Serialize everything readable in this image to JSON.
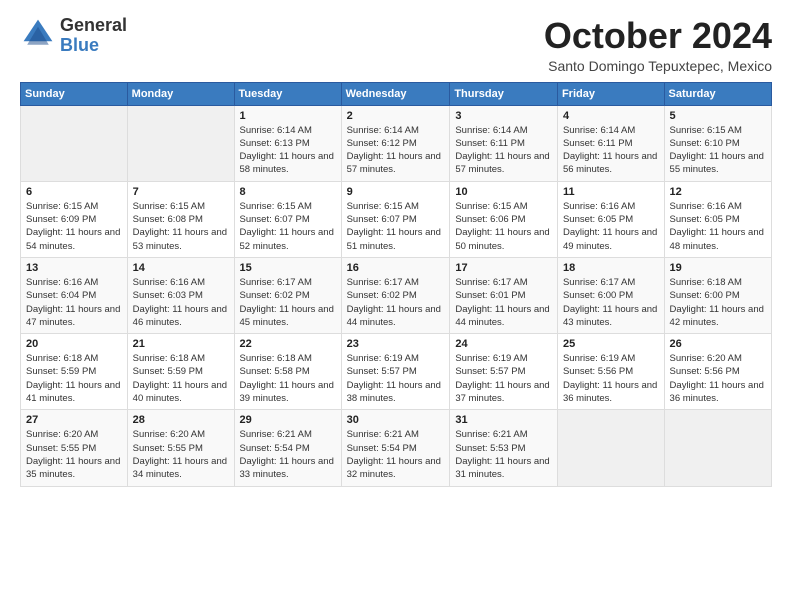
{
  "logo": {
    "general": "General",
    "blue": "Blue"
  },
  "title": "October 2024",
  "subtitle": "Santo Domingo Tepuxtepec, Mexico",
  "days_of_week": [
    "Sunday",
    "Monday",
    "Tuesday",
    "Wednesday",
    "Thursday",
    "Friday",
    "Saturday"
  ],
  "weeks": [
    [
      {
        "day": "",
        "sunrise": "",
        "sunset": "",
        "daylight": "",
        "empty": true
      },
      {
        "day": "",
        "sunrise": "",
        "sunset": "",
        "daylight": "",
        "empty": true
      },
      {
        "day": "1",
        "sunrise": "Sunrise: 6:14 AM",
        "sunset": "Sunset: 6:13 PM",
        "daylight": "Daylight: 11 hours and 58 minutes.",
        "empty": false
      },
      {
        "day": "2",
        "sunrise": "Sunrise: 6:14 AM",
        "sunset": "Sunset: 6:12 PM",
        "daylight": "Daylight: 11 hours and 57 minutes.",
        "empty": false
      },
      {
        "day": "3",
        "sunrise": "Sunrise: 6:14 AM",
        "sunset": "Sunset: 6:11 PM",
        "daylight": "Daylight: 11 hours and 57 minutes.",
        "empty": false
      },
      {
        "day": "4",
        "sunrise": "Sunrise: 6:14 AM",
        "sunset": "Sunset: 6:11 PM",
        "daylight": "Daylight: 11 hours and 56 minutes.",
        "empty": false
      },
      {
        "day": "5",
        "sunrise": "Sunrise: 6:15 AM",
        "sunset": "Sunset: 6:10 PM",
        "daylight": "Daylight: 11 hours and 55 minutes.",
        "empty": false
      }
    ],
    [
      {
        "day": "6",
        "sunrise": "Sunrise: 6:15 AM",
        "sunset": "Sunset: 6:09 PM",
        "daylight": "Daylight: 11 hours and 54 minutes.",
        "empty": false
      },
      {
        "day": "7",
        "sunrise": "Sunrise: 6:15 AM",
        "sunset": "Sunset: 6:08 PM",
        "daylight": "Daylight: 11 hours and 53 minutes.",
        "empty": false
      },
      {
        "day": "8",
        "sunrise": "Sunrise: 6:15 AM",
        "sunset": "Sunset: 6:07 PM",
        "daylight": "Daylight: 11 hours and 52 minutes.",
        "empty": false
      },
      {
        "day": "9",
        "sunrise": "Sunrise: 6:15 AM",
        "sunset": "Sunset: 6:07 PM",
        "daylight": "Daylight: 11 hours and 51 minutes.",
        "empty": false
      },
      {
        "day": "10",
        "sunrise": "Sunrise: 6:15 AM",
        "sunset": "Sunset: 6:06 PM",
        "daylight": "Daylight: 11 hours and 50 minutes.",
        "empty": false
      },
      {
        "day": "11",
        "sunrise": "Sunrise: 6:16 AM",
        "sunset": "Sunset: 6:05 PM",
        "daylight": "Daylight: 11 hours and 49 minutes.",
        "empty": false
      },
      {
        "day": "12",
        "sunrise": "Sunrise: 6:16 AM",
        "sunset": "Sunset: 6:05 PM",
        "daylight": "Daylight: 11 hours and 48 minutes.",
        "empty": false
      }
    ],
    [
      {
        "day": "13",
        "sunrise": "Sunrise: 6:16 AM",
        "sunset": "Sunset: 6:04 PM",
        "daylight": "Daylight: 11 hours and 47 minutes.",
        "empty": false
      },
      {
        "day": "14",
        "sunrise": "Sunrise: 6:16 AM",
        "sunset": "Sunset: 6:03 PM",
        "daylight": "Daylight: 11 hours and 46 minutes.",
        "empty": false
      },
      {
        "day": "15",
        "sunrise": "Sunrise: 6:17 AM",
        "sunset": "Sunset: 6:02 PM",
        "daylight": "Daylight: 11 hours and 45 minutes.",
        "empty": false
      },
      {
        "day": "16",
        "sunrise": "Sunrise: 6:17 AM",
        "sunset": "Sunset: 6:02 PM",
        "daylight": "Daylight: 11 hours and 44 minutes.",
        "empty": false
      },
      {
        "day": "17",
        "sunrise": "Sunrise: 6:17 AM",
        "sunset": "Sunset: 6:01 PM",
        "daylight": "Daylight: 11 hours and 44 minutes.",
        "empty": false
      },
      {
        "day": "18",
        "sunrise": "Sunrise: 6:17 AM",
        "sunset": "Sunset: 6:00 PM",
        "daylight": "Daylight: 11 hours and 43 minutes.",
        "empty": false
      },
      {
        "day": "19",
        "sunrise": "Sunrise: 6:18 AM",
        "sunset": "Sunset: 6:00 PM",
        "daylight": "Daylight: 11 hours and 42 minutes.",
        "empty": false
      }
    ],
    [
      {
        "day": "20",
        "sunrise": "Sunrise: 6:18 AM",
        "sunset": "Sunset: 5:59 PM",
        "daylight": "Daylight: 11 hours and 41 minutes.",
        "empty": false
      },
      {
        "day": "21",
        "sunrise": "Sunrise: 6:18 AM",
        "sunset": "Sunset: 5:59 PM",
        "daylight": "Daylight: 11 hours and 40 minutes.",
        "empty": false
      },
      {
        "day": "22",
        "sunrise": "Sunrise: 6:18 AM",
        "sunset": "Sunset: 5:58 PM",
        "daylight": "Daylight: 11 hours and 39 minutes.",
        "empty": false
      },
      {
        "day": "23",
        "sunrise": "Sunrise: 6:19 AM",
        "sunset": "Sunset: 5:57 PM",
        "daylight": "Daylight: 11 hours and 38 minutes.",
        "empty": false
      },
      {
        "day": "24",
        "sunrise": "Sunrise: 6:19 AM",
        "sunset": "Sunset: 5:57 PM",
        "daylight": "Daylight: 11 hours and 37 minutes.",
        "empty": false
      },
      {
        "day": "25",
        "sunrise": "Sunrise: 6:19 AM",
        "sunset": "Sunset: 5:56 PM",
        "daylight": "Daylight: 11 hours and 36 minutes.",
        "empty": false
      },
      {
        "day": "26",
        "sunrise": "Sunrise: 6:20 AM",
        "sunset": "Sunset: 5:56 PM",
        "daylight": "Daylight: 11 hours and 36 minutes.",
        "empty": false
      }
    ],
    [
      {
        "day": "27",
        "sunrise": "Sunrise: 6:20 AM",
        "sunset": "Sunset: 5:55 PM",
        "daylight": "Daylight: 11 hours and 35 minutes.",
        "empty": false
      },
      {
        "day": "28",
        "sunrise": "Sunrise: 6:20 AM",
        "sunset": "Sunset: 5:55 PM",
        "daylight": "Daylight: 11 hours and 34 minutes.",
        "empty": false
      },
      {
        "day": "29",
        "sunrise": "Sunrise: 6:21 AM",
        "sunset": "Sunset: 5:54 PM",
        "daylight": "Daylight: 11 hours and 33 minutes.",
        "empty": false
      },
      {
        "day": "30",
        "sunrise": "Sunrise: 6:21 AM",
        "sunset": "Sunset: 5:54 PM",
        "daylight": "Daylight: 11 hours and 32 minutes.",
        "empty": false
      },
      {
        "day": "31",
        "sunrise": "Sunrise: 6:21 AM",
        "sunset": "Sunset: 5:53 PM",
        "daylight": "Daylight: 11 hours and 31 minutes.",
        "empty": false
      },
      {
        "day": "",
        "sunrise": "",
        "sunset": "",
        "daylight": "",
        "empty": true
      },
      {
        "day": "",
        "sunrise": "",
        "sunset": "",
        "daylight": "",
        "empty": true
      }
    ]
  ]
}
